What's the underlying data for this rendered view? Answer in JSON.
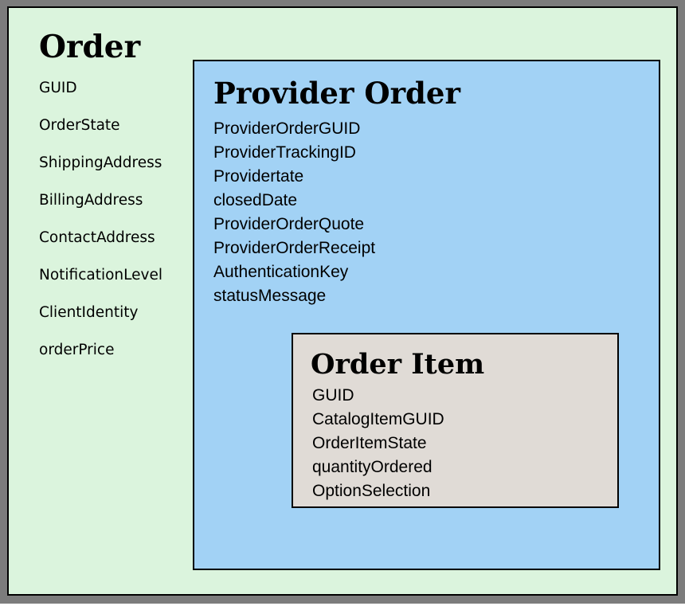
{
  "order": {
    "title": "Order",
    "fields": [
      "GUID",
      "OrderState",
      "ShippingAddress",
      "BillingAddress",
      "ContactAddress",
      "NotificationLevel",
      "ClientIdentity",
      "orderPrice"
    ]
  },
  "provider_order": {
    "title": "Provider Order",
    "fields": [
      "ProviderOrderGUID",
      "ProviderTrackingID",
      "Providertate",
      "closedDate",
      "ProviderOrderQuote",
      "ProviderOrderReceipt",
      "AuthenticationKey",
      "statusMessage"
    ]
  },
  "order_item": {
    "title": "Order Item",
    "fields": [
      "GUID",
      "CatalogItemGUID",
      "OrderItemState",
      "quantityOrdered",
      "OptionSelection"
    ]
  },
  "colors": {
    "frame": "#7c7c7c",
    "order_fill": "#dbf4dd",
    "provider_order_fill": "#a2d2f5",
    "order_item_fill": "#e0dbd6",
    "border": "#000000"
  }
}
